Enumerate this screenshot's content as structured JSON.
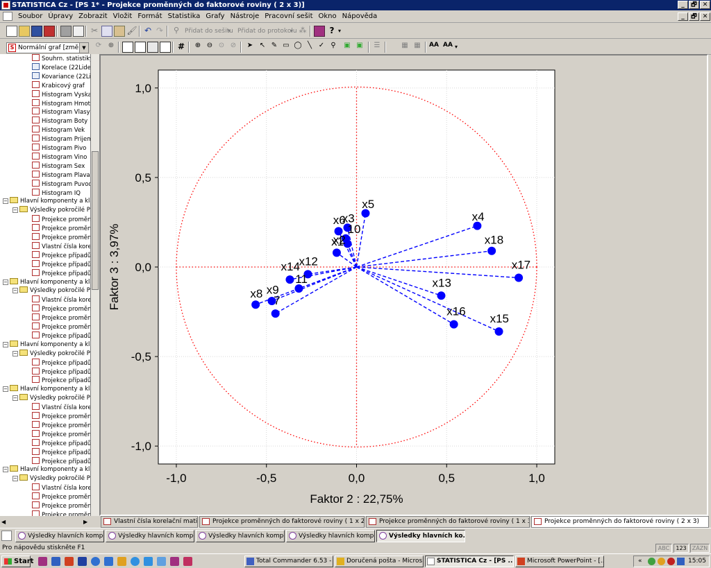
{
  "window": {
    "title": "STATISTICA Cz - [PS 1* - Projekce proměnných do faktorové roviny        ( 2 x   3)]",
    "controls": [
      "_",
      "🗗",
      "✕"
    ]
  },
  "menu": [
    "Soubor",
    "Úpravy",
    "Zobrazit",
    "Vložit",
    "Formát",
    "Statistika",
    "Grafy",
    "Nástroje",
    "Pracovní sešit",
    "Okno",
    "Nápověda"
  ],
  "toolbar1": {
    "add_to_workbook": "Přidat do sešitu",
    "add_to_report": "Přidat do protokolu"
  },
  "toolbar2": {
    "graph_type": "Normální graf [změ..."
  },
  "tree": {
    "items": [
      {
        "label": "Souhrn. statistiky",
        "kind": "graph",
        "indent": 3
      },
      {
        "label": "Korelace (22Lide.",
        "kind": "sheet",
        "indent": 3
      },
      {
        "label": "Kovariance (22Lid",
        "kind": "sheet",
        "indent": 3
      },
      {
        "label": "Krabicový graf",
        "kind": "graph",
        "indent": 3
      },
      {
        "label": "Histogram Vyska",
        "kind": "graph",
        "indent": 3
      },
      {
        "label": "Histogram Hmotn",
        "kind": "graph",
        "indent": 3
      },
      {
        "label": "Histogram Vlasy",
        "kind": "graph",
        "indent": 3
      },
      {
        "label": "Histogram Boty",
        "kind": "graph",
        "indent": 3
      },
      {
        "label": "Histogram Vek",
        "kind": "graph",
        "indent": 3
      },
      {
        "label": "Histogram Prijem",
        "kind": "graph",
        "indent": 3
      },
      {
        "label": "Histogram Pivo",
        "kind": "graph",
        "indent": 3
      },
      {
        "label": "Histogram Vino",
        "kind": "graph",
        "indent": 3
      },
      {
        "label": "Histogram Sex",
        "kind": "graph",
        "indent": 3
      },
      {
        "label": "Histogram Plavan",
        "kind": "graph",
        "indent": 3
      },
      {
        "label": "Histogram Puvod",
        "kind": "graph",
        "indent": 3
      },
      {
        "label": "Histogram IQ",
        "kind": "graph",
        "indent": 3
      },
      {
        "label": "Hlavní komponenty a klas",
        "kind": "folder",
        "indent": 0
      },
      {
        "label": "Výsledky pokročilé PC",
        "kind": "folder",
        "indent": 1
      },
      {
        "label": "Projekce proměnn",
        "kind": "graph",
        "indent": 3
      },
      {
        "label": "Projekce proměnn",
        "kind": "graph",
        "indent": 3
      },
      {
        "label": "Projekce proměnn",
        "kind": "graph",
        "indent": 3
      },
      {
        "label": "Vlastní čísla korel",
        "kind": "graph",
        "indent": 3
      },
      {
        "label": "Projekce případů",
        "kind": "graph",
        "indent": 3
      },
      {
        "label": "Projekce případů",
        "kind": "graph",
        "indent": 3
      },
      {
        "label": "Projekce případů",
        "kind": "graph",
        "indent": 3
      },
      {
        "label": "Hlavní komponenty a klas",
        "kind": "folder",
        "indent": 0
      },
      {
        "label": "Výsledky pokročilé PC",
        "kind": "folder",
        "indent": 1
      },
      {
        "label": "Vlastní čísla  korel",
        "kind": "graph",
        "indent": 3
      },
      {
        "label": "Projekce proměnn",
        "kind": "graph",
        "indent": 3
      },
      {
        "label": "Projekce proměnn",
        "kind": "graph",
        "indent": 3
      },
      {
        "label": "Projekce proměnn",
        "kind": "graph",
        "indent": 3
      },
      {
        "label": "Projekce případů",
        "kind": "graph",
        "indent": 3
      },
      {
        "label": "Hlavní komponenty a klas",
        "kind": "folder",
        "indent": 0
      },
      {
        "label": "Výsledky pokročilé PC",
        "kind": "folder",
        "indent": 1
      },
      {
        "label": "Projekce případů",
        "kind": "graph",
        "indent": 3
      },
      {
        "label": "Projekce případů",
        "kind": "graph",
        "indent": 3
      },
      {
        "label": "Projekce případů",
        "kind": "graph",
        "indent": 3
      },
      {
        "label": "Hlavní komponenty a klas",
        "kind": "folder",
        "indent": 0
      },
      {
        "label": "Výsledky pokročilé PC",
        "kind": "folder",
        "indent": 1
      },
      {
        "label": "Vlastní čísla  korel",
        "kind": "graph",
        "indent": 3
      },
      {
        "label": "Projekce proměnn",
        "kind": "graph",
        "indent": 3
      },
      {
        "label": "Projekce proměnn",
        "kind": "graph",
        "indent": 3
      },
      {
        "label": "Projekce proměnn",
        "kind": "graph",
        "indent": 3
      },
      {
        "label": "Projekce případů",
        "kind": "graph",
        "indent": 3
      },
      {
        "label": "Projekce případů",
        "kind": "graph",
        "indent": 3
      },
      {
        "label": "Projekce případů",
        "kind": "graph",
        "indent": 3
      },
      {
        "label": "Hlavní komponenty a klas",
        "kind": "folder",
        "indent": 0
      },
      {
        "label": "Výsledky pokročilé PC",
        "kind": "folder",
        "indent": 1
      },
      {
        "label": "Vlastní čísla  korel",
        "kind": "graph",
        "indent": 3
      },
      {
        "label": "Projekce proměnn",
        "kind": "graph",
        "indent": 3
      },
      {
        "label": "Projekce proměnn",
        "kind": "graph",
        "indent": 3
      },
      {
        "label": "Projekce proměnn",
        "kind": "graph",
        "indent": 3
      }
    ]
  },
  "tabs": [
    {
      "label": "Vlastní čísla  korelační matice"
    },
    {
      "label": "Projekce proměnných do faktorové roviny        ( 1 x   2)"
    },
    {
      "label": "Projekce proměnných do faktorové roviny        ( 1 x   3)"
    },
    {
      "label": "Projekce proměnných do faktorové roviny        ( 2 x   3)"
    }
  ],
  "workbooks": [
    {
      "label": "Výsledky hlavních kompo..."
    },
    {
      "label": "Výsledky hlavních kompo..."
    },
    {
      "label": "Výsledky hlavních kompo..."
    },
    {
      "label": "Výsledky hlavních kompo..."
    },
    {
      "label": "Výsledky hlavních ko..."
    }
  ],
  "status": {
    "help": "Pro nápovědu stiskněte F1",
    "abc": "ABC",
    "num": "123",
    "ins": "ZÁZN"
  },
  "taskbar": {
    "start": "Start",
    "tasks": [
      "Total Commander 6.53 - ...",
      "Doručená pošta - Micros...",
      "STATISTICA Cz - [PS ...",
      "Microsoft PowerPoint - [..."
    ],
    "clock": "15:05"
  },
  "chart_data": {
    "type": "scatter",
    "xlabel": "Faktor 2 : 22,75%",
    "ylabel": "Faktor 3 :  3,97%",
    "xlim": [
      -1.1,
      1.1
    ],
    "ylim": [
      -1.1,
      1.1
    ],
    "xticks": [
      "-1,0",
      "-0,5",
      "0,0",
      "0,5",
      "1,0"
    ],
    "yticks": [
      "1,0",
      "0,5",
      "0,0",
      "-0,5",
      "-1,0"
    ],
    "tick_values": [
      -1.0,
      -0.5,
      0.0,
      0.5,
      1.0
    ],
    "grid": true,
    "unit_circle": true,
    "point_color": "#0000ff",
    "circle_color": "#ff0000",
    "points": [
      {
        "label": "x5",
        "x": 0.05,
        "y": 0.3,
        "lx": 0.03,
        "ly": 0.33
      },
      {
        "label": "x4",
        "x": 0.67,
        "y": 0.23,
        "lx": 0.64,
        "ly": 0.26
      },
      {
        "label": "x18",
        "x": 0.75,
        "y": 0.09,
        "lx": 0.71,
        "ly": 0.13
      },
      {
        "label": "x17",
        "x": 0.9,
        "y": -0.06,
        "lx": 0.86,
        "ly": -0.01
      },
      {
        "label": "x13",
        "x": 0.47,
        "y": -0.16,
        "lx": 0.42,
        "ly": -0.11
      },
      {
        "label": "x16",
        "x": 0.54,
        "y": -0.32,
        "lx": 0.5,
        "ly": -0.27
      },
      {
        "label": "x15",
        "x": 0.79,
        "y": -0.36,
        "lx": 0.74,
        "ly": -0.31
      },
      {
        "label": "x3",
        "x": -0.05,
        "y": 0.22,
        "lx": -0.08,
        "ly": 0.25
      },
      {
        "label": "x6",
        "x": -0.1,
        "y": 0.2,
        "lx": -0.13,
        "ly": 0.24
      },
      {
        "label": "10",
        "x": -0.06,
        "y": 0.16,
        "lx": -0.05,
        "ly": 0.19
      },
      {
        "label": "x2",
        "x": -0.05,
        "y": 0.13,
        "lx": -0.13,
        "ly": 0.13
      },
      {
        "label": "x1",
        "x": -0.11,
        "y": 0.08,
        "lx": -0.14,
        "ly": 0.12
      },
      {
        "label": "x12",
        "x": -0.27,
        "y": -0.04,
        "lx": -0.32,
        "ly": 0.01
      },
      {
        "label": "x14",
        "x": -0.37,
        "y": -0.07,
        "lx": -0.42,
        "ly": -0.02
      },
      {
        "label": "11",
        "x": -0.32,
        "y": -0.12,
        "lx": -0.34,
        "ly": -0.09
      },
      {
        "label": "x9",
        "x": -0.47,
        "y": -0.19,
        "lx": -0.5,
        "ly": -0.15
      },
      {
        "label": "x8",
        "x": -0.56,
        "y": -0.21,
        "lx": -0.59,
        "ly": -0.17
      },
      {
        "label": "7",
        "x": -0.45,
        "y": -0.26,
        "lx": -0.46,
        "ly": -0.21
      }
    ]
  }
}
